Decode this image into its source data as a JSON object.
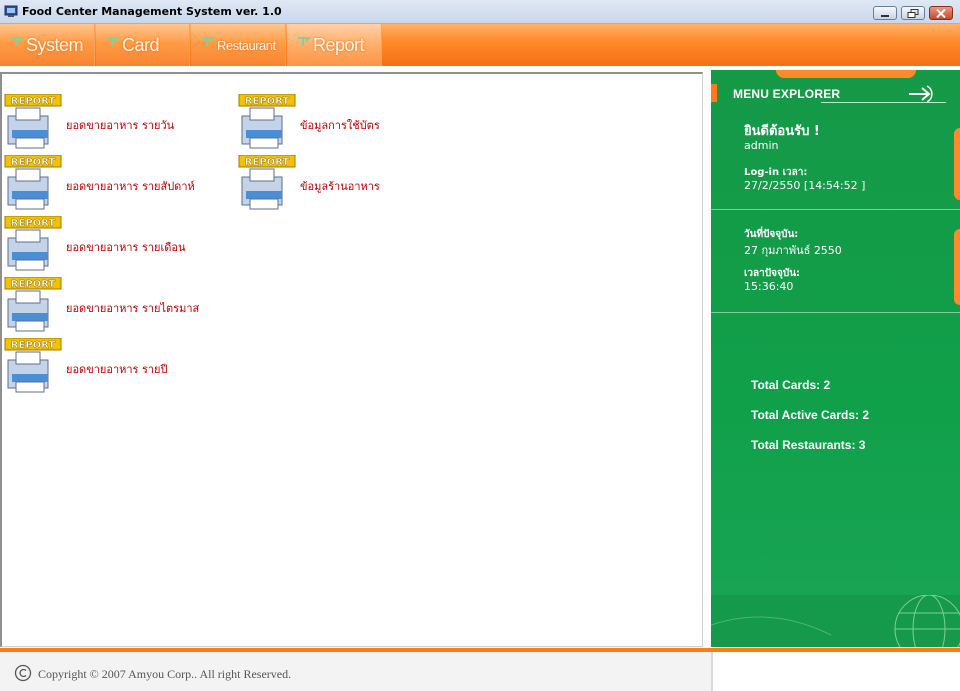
{
  "window": {
    "title": "Food Center Management System ver. 1.0"
  },
  "nav": {
    "tabs": [
      {
        "label": "System",
        "active": false
      },
      {
        "label": "Card",
        "active": false
      },
      {
        "label": "Restaurant",
        "active": false
      },
      {
        "label": "Report",
        "active": true
      }
    ]
  },
  "reports": {
    "badge": "REPORT",
    "items": [
      {
        "label": "ยอดขายอาหาร รายวัน"
      },
      {
        "label": "ยอดขายอาหาร รายสัปดาห์"
      },
      {
        "label": "ยอดขายอาหาร รายเดือน"
      },
      {
        "label": "ยอดขายอาหาร รายไตรมาส"
      },
      {
        "label": "ยอดขายอาหาร รายปี"
      },
      {
        "label": "ข้อมูลการใช้บัตร"
      },
      {
        "label": "ข้อมูลร้านอาหาร"
      }
    ]
  },
  "menu_explorer": {
    "title": "MENU EXPLORER",
    "welcome": "ยินดีต้อนรับ !",
    "username": "admin",
    "login_time_label": "Log-in เวลา:",
    "login_time_value": "27/2/2550 [14:54:52 ]",
    "current_date_label": "วันที่ปัจจุบัน:",
    "current_date_value": "27 กุมภาพันธ์ 2550",
    "current_time_label": "เวลาปัจจุบัน:",
    "current_time_value": "15:36:40",
    "stats": {
      "total_cards": "Total Cards: 2",
      "total_active_cards": "Total Active Cards: 2",
      "total_restaurants": "Total Restaurants: 3"
    }
  },
  "footer": {
    "copyright": "Copyright © 2007 Amyou Corp.. All right Reserved."
  },
  "colors": {
    "accent_orange": "#ff8a2a",
    "panel_green": "#159947",
    "link_red": "#c00000"
  }
}
